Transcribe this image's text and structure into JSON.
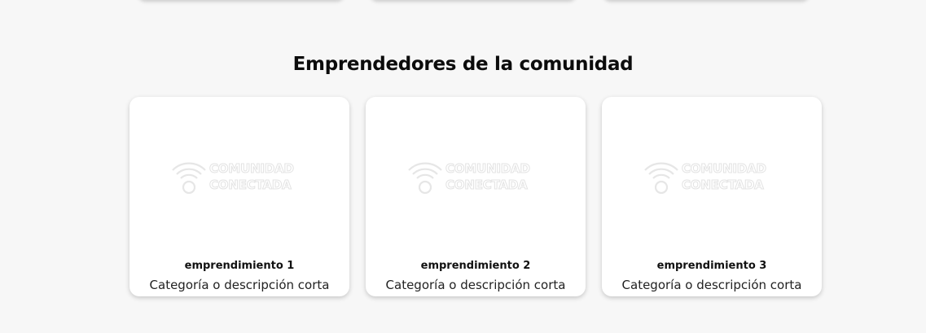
{
  "section": {
    "title": "Emprendedores de la comunidad"
  },
  "logo": {
    "line1": "COMUNIDAD",
    "line2": "CONECTADA",
    "icon": "wifi-icon"
  },
  "cards": [
    {
      "name": "emprendimiento 1",
      "description": "Categoría o descripción corta"
    },
    {
      "name": "emprendimiento 2",
      "description": "Categoría o descripción corta"
    },
    {
      "name": "emprendimiento 3",
      "description": "Categoría o descripción corta"
    }
  ],
  "colors": {
    "background": "#f7f7f7",
    "card": "#ffffff",
    "logo_outline": "#e3e3e3"
  }
}
